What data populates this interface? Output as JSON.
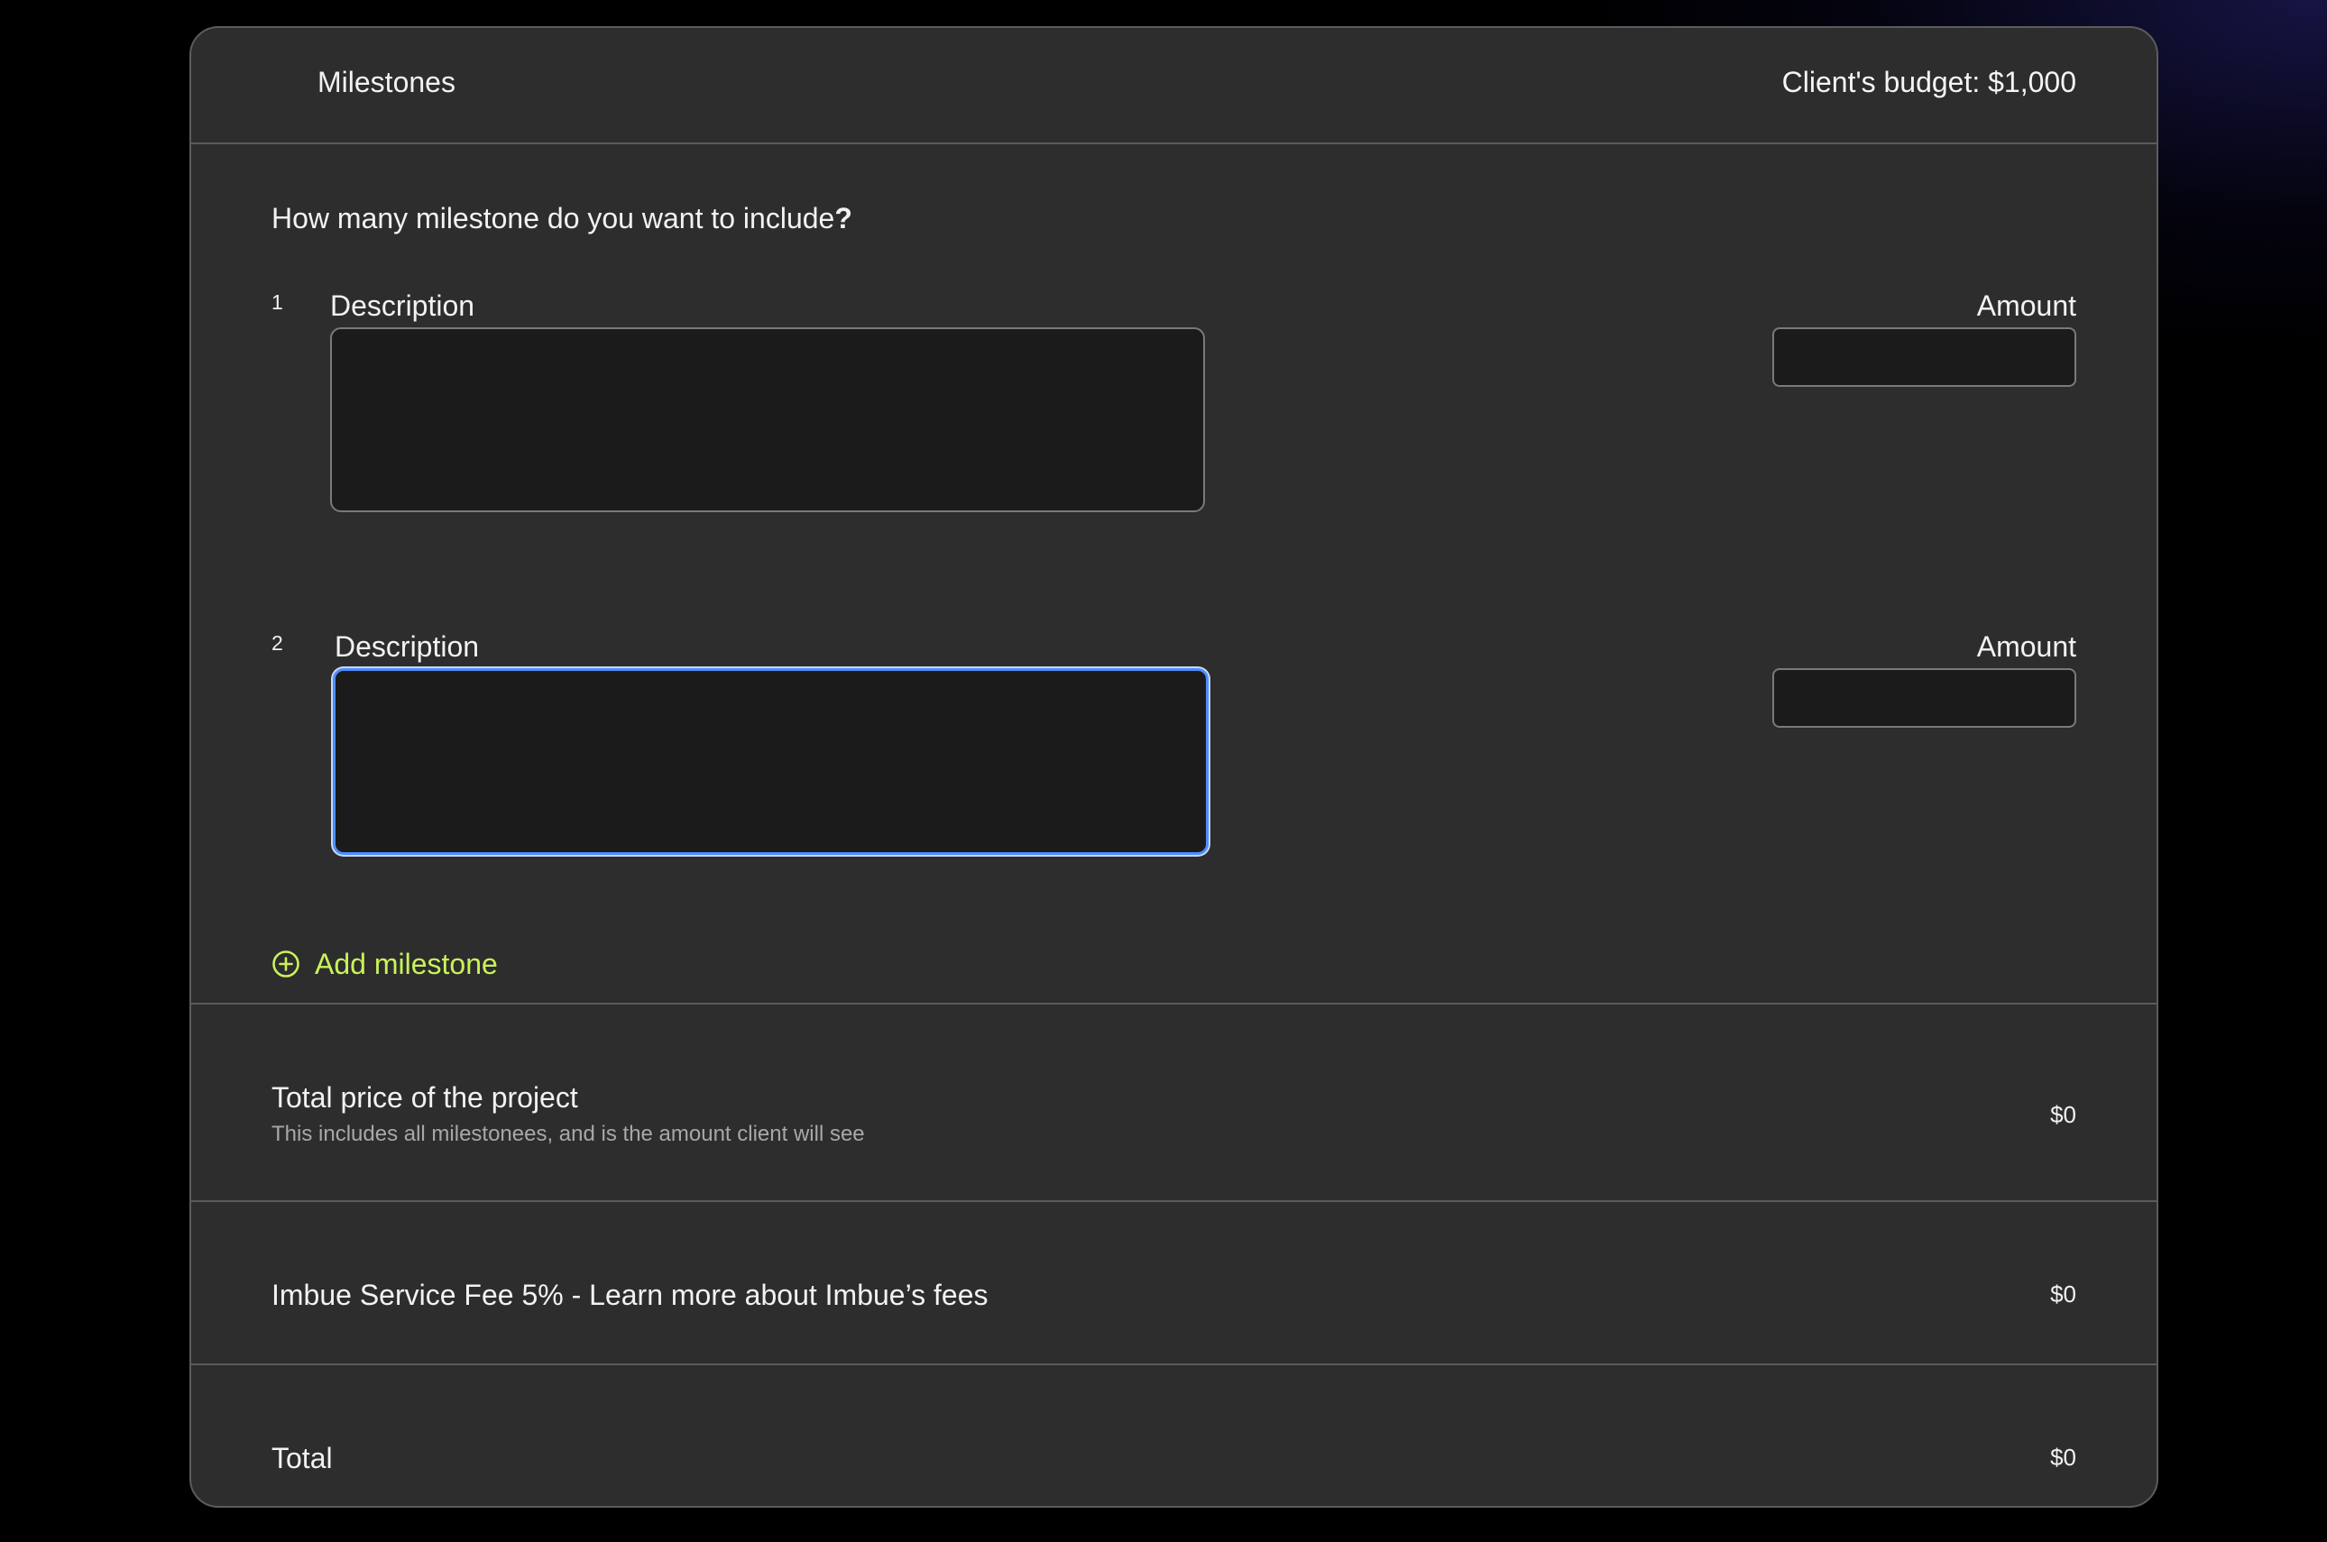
{
  "header": {
    "title": "Milestones",
    "budget": "Client's budget: $1,000"
  },
  "question": {
    "text": "How many milestone do you want to include",
    "mark": "?"
  },
  "milestones": [
    {
      "number": "1",
      "description_label": "Description",
      "amount_label": "Amount",
      "description_value": "",
      "amount_value": ""
    },
    {
      "number": "2",
      "description_label": "Description",
      "amount_label": "Amount",
      "description_value": "",
      "amount_value": ""
    }
  ],
  "add_milestone": {
    "label": "Add milestone",
    "icon": "plus-circle-icon",
    "color": "#c9f25a"
  },
  "summary": {
    "total_price": {
      "title": "Total price of the project",
      "subtitle": "This includes all milestonees, and is the amount client will see",
      "value": "$0"
    },
    "service_fee": {
      "title": "Imbue Service Fee 5% - Learn more about Imbue’s fees",
      "value": "$0"
    },
    "total": {
      "title": "Total",
      "value": "$0"
    }
  },
  "colors": {
    "background": "#000000",
    "card": "#2d2d2d",
    "input": "#1b1b1b",
    "focus_ring": "#4d8dff",
    "accent": "#c9f25a"
  }
}
